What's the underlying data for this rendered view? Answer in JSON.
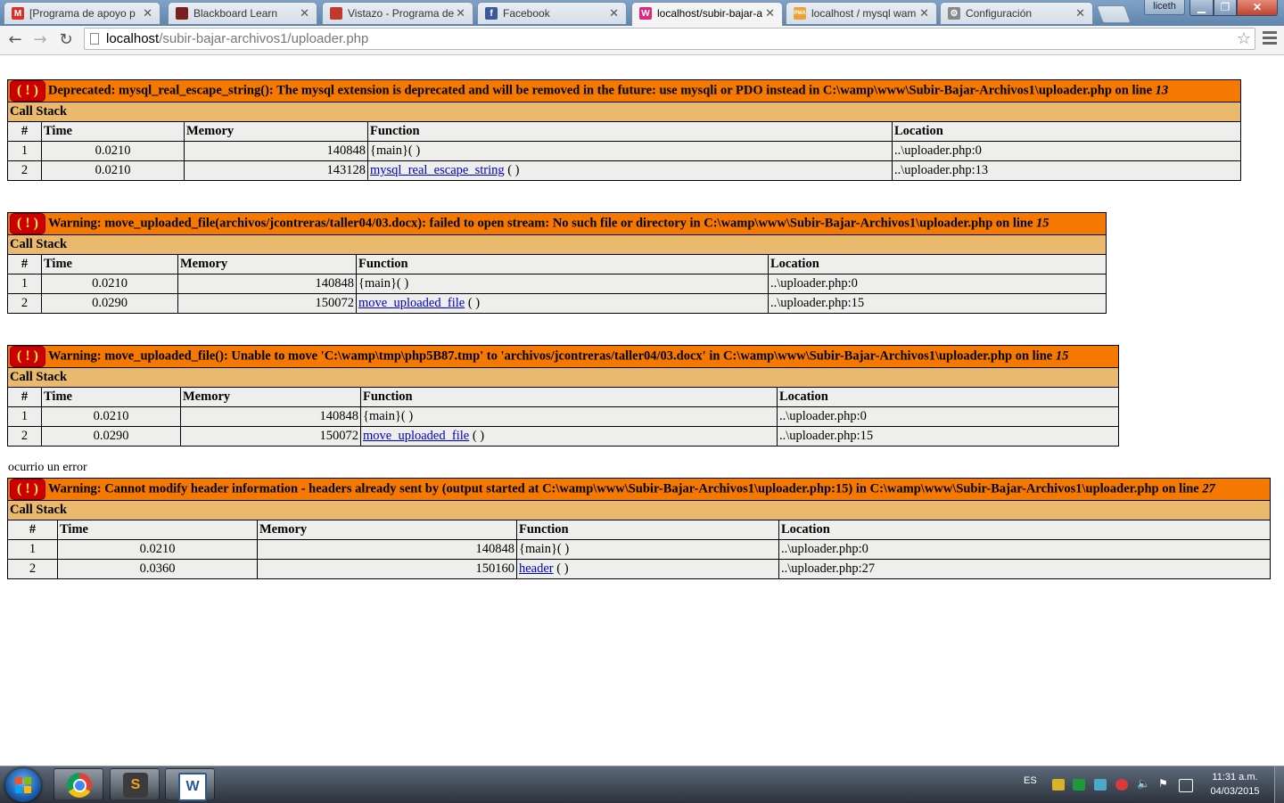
{
  "browser": {
    "tabs": [
      {
        "title": "[Programa de apoyo p",
        "icon": "gmail-icon",
        "color": "#d93025",
        "glyph": "M"
      },
      {
        "title": "Blackboard Learn",
        "icon": "blackboard-icon",
        "color": "#7a1f1f",
        "glyph": ""
      },
      {
        "title": "Vistazo - Programa de",
        "icon": "vistazo-icon",
        "color": "#c0392b",
        "glyph": ""
      },
      {
        "title": "Facebook",
        "icon": "facebook-icon",
        "color": "#3b5998",
        "glyph": "f"
      },
      {
        "title": "localhost/subir-bajar-a",
        "icon": "localhost-icon",
        "color": "#e0287a",
        "glyph": "W"
      },
      {
        "title": "localhost / mysql wam",
        "icon": "phpmyadmin-icon",
        "color": "#e8a33b",
        "glyph": "PMA"
      },
      {
        "title": "Configuración",
        "icon": "gear-icon",
        "color": "#888888",
        "glyph": "⚙"
      }
    ],
    "active_tab_index": 4,
    "profile_name": "liceth",
    "address": {
      "host": "localhost",
      "path": "/subir-bajar-archivos1/uploader.php"
    }
  },
  "errors": [
    {
      "message": "Deprecated: mysql_real_escape_string(): The mysql extension is deprecated and will be removed in the future: use mysqli or PDO instead in C:\\wamp\\www\\Subir-Bajar-Archivos1\\uploader.php on line ",
      "line": "13",
      "call_stack_label": "Call Stack",
      "headers": [
        "#",
        "Time",
        "Memory",
        "Function",
        "Location"
      ],
      "rows": [
        {
          "num": "1",
          "time": "0.0210",
          "memory": "140848",
          "func": "{main}",
          "func_link": false,
          "func_suffix": "( )",
          "location": "..\\uploader.php:0"
        },
        {
          "num": "2",
          "time": "0.0210",
          "memory": "143128",
          "func": "mysql_real_escape_string",
          "func_link": true,
          "func_suffix": " ( )",
          "location": "..\\uploader.php:13"
        }
      ]
    },
    {
      "message": "Warning: move_uploaded_file(archivos/jcontreras/taller04/03.docx): failed to open stream: No such file or directory in C:\\wamp\\www\\Subir-Bajar-Archivos1\\uploader.php on line ",
      "line": "15",
      "call_stack_label": "Call Stack",
      "headers": [
        "#",
        "Time",
        "Memory",
        "Function",
        "Location"
      ],
      "rows": [
        {
          "num": "1",
          "time": "0.0210",
          "memory": "140848",
          "func": "{main}",
          "func_link": false,
          "func_suffix": "( )",
          "location": "..\\uploader.php:0"
        },
        {
          "num": "2",
          "time": "0.0290",
          "memory": "150072",
          "func": "move_uploaded_file",
          "func_link": true,
          "func_suffix": " ( )",
          "location": "..\\uploader.php:15"
        }
      ]
    },
    {
      "message": "Warning: move_uploaded_file(): Unable to move 'C:\\wamp\\tmp\\php5B87.tmp' to 'archivos/jcontreras/taller04/03.docx' in C:\\wamp\\www\\Subir-Bajar-Archivos1\\uploader.php on line ",
      "line": "15",
      "call_stack_label": "Call Stack",
      "headers": [
        "#",
        "Time",
        "Memory",
        "Function",
        "Location"
      ],
      "rows": [
        {
          "num": "1",
          "time": "0.0210",
          "memory": "140848",
          "func": "{main}",
          "func_link": false,
          "func_suffix": "( )",
          "location": "..\\uploader.php:0"
        },
        {
          "num": "2",
          "time": "0.0290",
          "memory": "150072",
          "func": "move_uploaded_file",
          "func_link": true,
          "func_suffix": " ( )",
          "location": "..\\uploader.php:15"
        }
      ]
    },
    {
      "message": "Warning: Cannot modify header information - headers already sent by (output started at C:\\wamp\\www\\Subir-Bajar-Archivos1\\uploader.php:15) in C:\\wamp\\www\\Subir-Bajar-Archivos1\\uploader.php on line ",
      "line": "27",
      "call_stack_label": "Call Stack",
      "headers": [
        "#",
        "Time",
        "Memory",
        "Function",
        "Location"
      ],
      "rows": [
        {
          "num": "1",
          "time": "0.0210",
          "memory": "140848",
          "func": "{main}",
          "func_link": false,
          "func_suffix": "( )",
          "location": "..\\uploader.php:0"
        },
        {
          "num": "2",
          "time": "0.0360",
          "memory": "150160",
          "func": "header",
          "func_link": true,
          "func_suffix": " ( )",
          "location": "..\\uploader.php:27"
        }
      ]
    }
  ],
  "plain_output": "ocurrio un error",
  "error_icon_text": "( ! )",
  "taskbar": {
    "apps": [
      {
        "name": "chrome-taskbar-button",
        "icon": "chrome-icon"
      },
      {
        "name": "sublime-taskbar-button",
        "icon": "sublime-icon",
        "glyph": "S"
      },
      {
        "name": "word-taskbar-button",
        "icon": "word-icon",
        "glyph": "W"
      }
    ],
    "language": "ES",
    "tray_icons": [
      "shield-icon",
      "green-app-icon",
      "network-device-icon",
      "chat-icon",
      "action-center-flag-icon",
      "volume-icon",
      "network-icon"
    ],
    "time": "11:31 a.m.",
    "date": "04/03/2015"
  },
  "colors": {
    "error_header": "#f57900",
    "call_stack": "#e9b96e",
    "row_bg": "#eeeeec",
    "error_icon_bg": "#cc0000",
    "error_icon_fg": "#fce94f",
    "link": "#0000cc"
  }
}
